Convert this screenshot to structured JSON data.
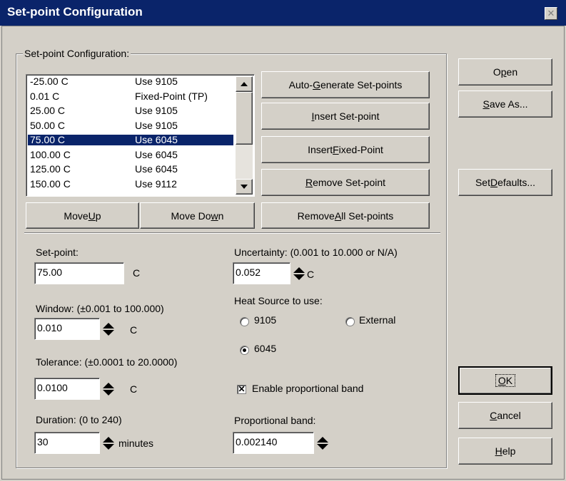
{
  "window": {
    "title": "Set-point Configuration",
    "close_glyph": "✕"
  },
  "group": {
    "label": "Set-point Configuration:"
  },
  "setpoints": [
    {
      "temp": "-25.00 C",
      "source": "Use 9105"
    },
    {
      "temp": "0.01 C",
      "source": "Fixed-Point (TP)"
    },
    {
      "temp": "25.00 C",
      "source": "Use 9105"
    },
    {
      "temp": "50.00 C",
      "source": "Use 9105"
    },
    {
      "temp": "75.00 C",
      "source": "Use 6045",
      "selected": true
    },
    {
      "temp": "100.00 C",
      "source": "Use 6045"
    },
    {
      "temp": "125.00 C",
      "source": "Use 6045"
    },
    {
      "temp": "150.00 C",
      "source": "Use 9112"
    }
  ],
  "buttons": {
    "auto_generate": {
      "pre": "Auto-",
      "acc": "G",
      "post": "enerate Set-points"
    },
    "insert_setpoint": {
      "pre": "",
      "acc": "I",
      "post": "nsert Set-point"
    },
    "insert_fixed": {
      "pre": "Insert ",
      "acc": "F",
      "post": "ixed-Point"
    },
    "remove_setpoint": {
      "pre": "",
      "acc": "R",
      "post": "emove Set-point"
    },
    "remove_all": {
      "pre": "Remove ",
      "acc": "A",
      "post": "ll Set-points"
    },
    "move_up": {
      "pre": "Move ",
      "acc": "U",
      "post": "p"
    },
    "move_down": {
      "pre": "Move Do",
      "acc": "w",
      "post": "n"
    },
    "open": {
      "pre": "O",
      "acc": "p",
      "post": "en"
    },
    "save_as": {
      "pre": "",
      "acc": "S",
      "post": "ave As..."
    },
    "set_defaults": {
      "pre": "Set ",
      "acc": "D",
      "post": "efaults..."
    },
    "ok": {
      "pre": "",
      "acc": "O",
      "post": "K"
    },
    "cancel": {
      "pre": "",
      "acc": "C",
      "post": "ancel"
    },
    "help": {
      "pre": "",
      "acc": "H",
      "post": "elp"
    }
  },
  "setpoint": {
    "label": "Set-point:",
    "value": "75.00",
    "unit": "C"
  },
  "window_field": {
    "label": "Window: (±0.001 to 100.000)",
    "value": "0.010",
    "unit": "C"
  },
  "tolerance": {
    "label": "Tolerance: (±0.0001 to 20.0000)",
    "value": "0.0100",
    "unit": "C"
  },
  "duration": {
    "label": "Duration: (0 to 240)",
    "value": "30",
    "unit": "minutes"
  },
  "uncertainty": {
    "label": "Uncertainty: (0.001 to 10.000 or N/A)",
    "value": "0.052",
    "unit": "C"
  },
  "heat_source": {
    "label": "Heat Source to use:",
    "options": [
      {
        "label": "9105",
        "selected": false
      },
      {
        "label": "External",
        "selected": false
      },
      {
        "label": "6045",
        "selected": true
      }
    ]
  },
  "proportional": {
    "enable_label": "Enable proportional band",
    "enabled": true,
    "check_glyph": "✕",
    "band_label": "Proportional band:",
    "band_value": "0.002140"
  }
}
